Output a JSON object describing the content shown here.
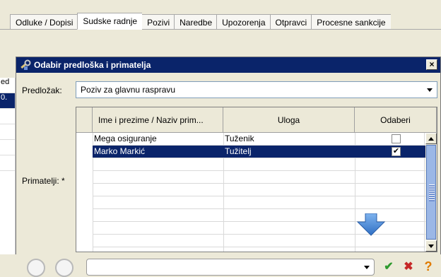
{
  "tabs": [
    {
      "label": "Odluke / Dopisi"
    },
    {
      "label": "Sudske radnje"
    },
    {
      "label": "Pozivi"
    },
    {
      "label": "Naredbe"
    },
    {
      "label": "Upozorenja"
    },
    {
      "label": "Otpravci"
    },
    {
      "label": "Procesne sankcije"
    }
  ],
  "background": {
    "left_cells": [
      "ed",
      "0."
    ]
  },
  "dialog": {
    "title": "Odabir predloška i primatelja",
    "close_label": "×",
    "template_label": "Predložak:",
    "template_value": "Poziv za glavnu raspravu",
    "recipients_label": "Primatelji: *",
    "columns": [
      "Ime i prezime / Naziv prim...",
      "Uloga",
      "Odaberi"
    ],
    "rows": [
      {
        "name": "Mega osiguranje",
        "role": "Tuženik",
        "selected": false
      },
      {
        "name": "Marko Markić",
        "role": "Tužitelj",
        "selected": true
      }
    ],
    "check_mark": "✔"
  },
  "bottom": {
    "confirm_icon": "✔",
    "cancel_icon": "✖",
    "help_icon": "?"
  },
  "colors": {
    "titlebar": "#0a246a",
    "selection": "#0a246a",
    "accent_arrow": "#4a90d9",
    "confirm": "#2e9a2e",
    "cancel": "#c62828",
    "help": "#e07b00"
  }
}
